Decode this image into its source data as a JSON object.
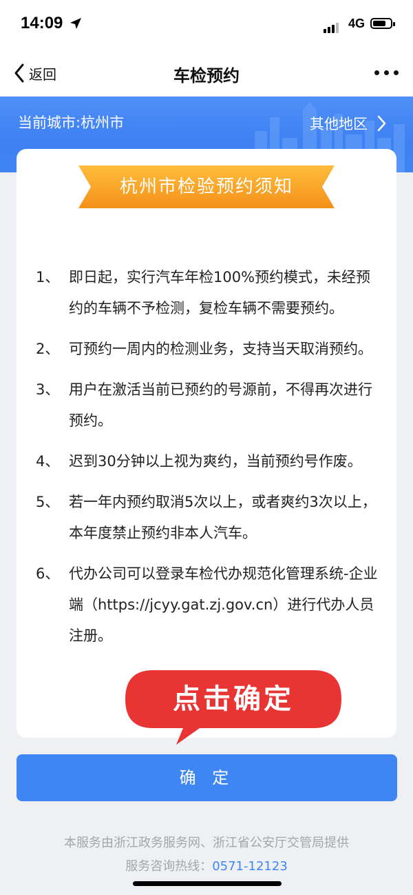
{
  "status_bar": {
    "time": "14:09",
    "network": "4G"
  },
  "nav": {
    "back_label": "返回",
    "title": "车检预约"
  },
  "banner": {
    "current_city": "当前城市:杭州市",
    "other_regions": "其他地区"
  },
  "notice": {
    "title": "杭州市检验预约须知",
    "rules": [
      {
        "num": "1、",
        "text": "即日起，实行汽车年检100%预约模式，未经预约的车辆不予检测，复检车辆不需要预约。"
      },
      {
        "num": "2、",
        "text": "可预约一周内的检测业务，支持当天取消预约。"
      },
      {
        "num": "3、",
        "text": "用户在激活当前已预约的号源前，不得再次进行预约。"
      },
      {
        "num": "4、",
        "text": "迟到30分钟以上视为爽约，当前预约号作废。"
      },
      {
        "num": "5、",
        "text": "若一年内预约取消5次以上，或者爽约3次以上，本年度禁止预约非本人汽车。"
      },
      {
        "num": "6、",
        "text": "代办公司可以登录车检代办规范化管理系统-企业端（https://jcyy.gat.zj.gov.cn）进行代办人员注册。"
      }
    ]
  },
  "callout": {
    "text": "点击确定"
  },
  "confirm_button": {
    "label": "确 定"
  },
  "footer": {
    "provider": "本服务由浙江政务服务网、浙江省公安厅交管局提供",
    "hotline_label": "服务咨询热线：",
    "hotline": "0571-12123"
  },
  "colors": {
    "accent": "#3f86f5",
    "ribbon": "#f5a020",
    "callout": "#e93434"
  }
}
